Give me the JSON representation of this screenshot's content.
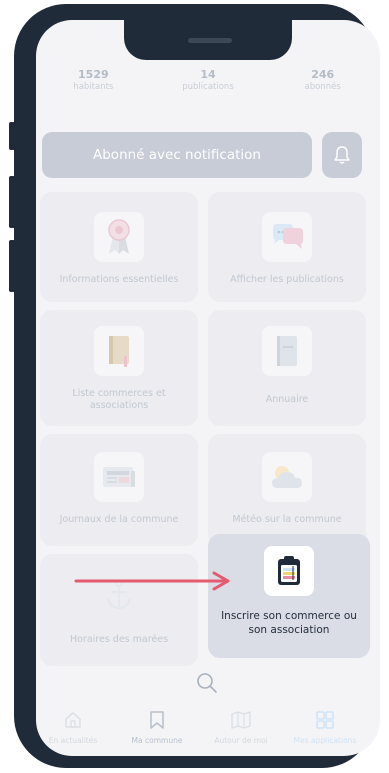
{
  "stats": [
    {
      "value": "1529",
      "label": "habitants"
    },
    {
      "value": "14",
      "label": "publications"
    },
    {
      "value": "246",
      "label": "abonnés"
    }
  ],
  "subscribe": {
    "label": "Abonné avec notification"
  },
  "tiles": [
    {
      "label": "Informations essentielles"
    },
    {
      "label": "Afficher les publications"
    },
    {
      "label": "Liste commerces et associations"
    },
    {
      "label": "Annuaire"
    },
    {
      "label": "Journaux de la commune"
    },
    {
      "label": "Météo sur la commune"
    },
    {
      "label": "Horaires des marées"
    },
    {
      "label": "Inscrire son commerce ou son association"
    }
  ],
  "nav": [
    {
      "label": "En actualités"
    },
    {
      "label": "Ma commune"
    },
    {
      "label": "Autour de moi"
    },
    {
      "label": "Mes applications"
    }
  ],
  "colors": {
    "frame": "#1f2b38",
    "arrow": "#e55a6e",
    "accent_blue": "#cfe3f5",
    "active_tile": "#dadde6"
  }
}
